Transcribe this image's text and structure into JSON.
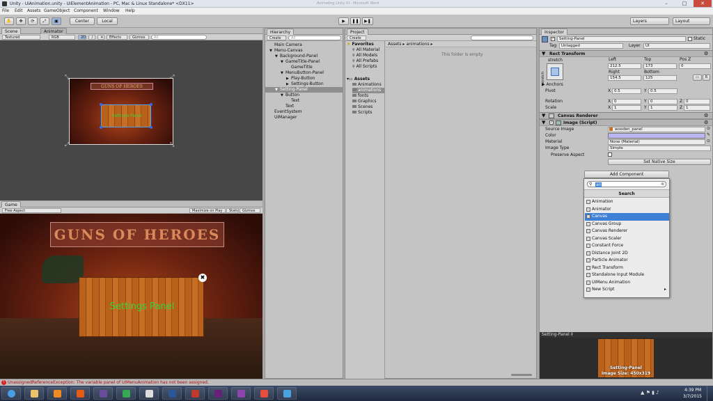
{
  "window": {
    "title": "Unity - UiAnimation.unity - UiElementAnimation - PC, Mac & Linux Standalone* <DX11>",
    "ghost_title": "Animating Unity UI - Microsoft Word",
    "min": "–",
    "max": "□",
    "close": "✕"
  },
  "menu": [
    "File",
    "Edit",
    "Assets",
    "GameObject",
    "Component",
    "Window",
    "Help"
  ],
  "toolbar": {
    "tools": [
      "✋",
      "✥",
      "⟳",
      "⤢",
      "▣"
    ],
    "pivot": "Center",
    "space": "Local",
    "play": "▶",
    "pause": "❚❚",
    "step": "▶❚",
    "layers": "Layers",
    "layout": "Layout"
  },
  "scene": {
    "tabs": [
      "Scene",
      "Animator"
    ],
    "shading": "Textured",
    "rgb": "RGB",
    "mode2d": "2D",
    "effects": "Effects",
    "gizmos": "Gizmos",
    "search_placeholder": "All",
    "panel_text": "Settings Panel",
    "logo_text": "GUNS OF HEROES"
  },
  "game": {
    "tab": "Game",
    "aspect": "Free Aspect",
    "maximize": "Maximize on Play",
    "stats": "Stats",
    "gizmos": "Gizmos",
    "panel_text": "Settings Panel",
    "logo_text": "GUNS OF HEROES",
    "close_glyph": "✖"
  },
  "hierarchy": {
    "tab": "Hierarchy",
    "create": "Create",
    "search_placeholder": "All",
    "items": [
      {
        "label": "Main Camera",
        "indent": 0,
        "arrow": ""
      },
      {
        "label": "Menu-Canvas",
        "indent": 0,
        "arrow": "▼"
      },
      {
        "label": "Background-Panel",
        "indent": 1,
        "arrow": "▼"
      },
      {
        "label": "GameTitle-Panel",
        "indent": 2,
        "arrow": "▼"
      },
      {
        "label": "GameTitle",
        "indent": 3,
        "arrow": ""
      },
      {
        "label": "MenuButton-Panel",
        "indent": 2,
        "arrow": "▼"
      },
      {
        "label": "Play-Button",
        "indent": 3,
        "arrow": "▶"
      },
      {
        "label": "Settings-Button",
        "indent": 3,
        "arrow": "▶"
      },
      {
        "label": "Setting-Panel",
        "indent": 1,
        "arrow": "▼",
        "selected": true
      },
      {
        "label": "Button",
        "indent": 2,
        "arrow": "▼"
      },
      {
        "label": "Text",
        "indent": 3,
        "arrow": ""
      },
      {
        "label": "Text",
        "indent": 2,
        "arrow": ""
      },
      {
        "label": "EventSystem",
        "indent": 0,
        "arrow": ""
      },
      {
        "label": "UIManager",
        "indent": 0,
        "arrow": ""
      }
    ]
  },
  "project": {
    "tab": "Project",
    "create": "Create",
    "breadcrumb": "Assets ▸ animations ▸",
    "empty": "This folder is empty",
    "favorites_label": "Favorites",
    "favorites": [
      "All Material",
      "All Models",
      "All Prefabs",
      "All Scripts"
    ],
    "assets_label": "Assets",
    "folders": [
      "Animations",
      "animations",
      "fonts",
      "Graphics",
      "Scenes",
      "Scripts"
    ]
  },
  "inspector": {
    "tab": "Inspector",
    "name": "Setting-Panel",
    "static": "Static",
    "tag_label": "Tag",
    "tag": "Untagged",
    "layer_label": "Layer",
    "layer": "UI",
    "rect_transform": "Rect Transform",
    "stretch": "stretch",
    "left_label": "Left",
    "top_label": "Top",
    "posz_label": "Pos Z",
    "left": "212.5",
    "top": "173",
    "posz": "0",
    "right_label": "Right",
    "bottom_label": "Bottom",
    "right": "154.5",
    "bottom": "125",
    "raw_btn": "R",
    "anchors": "Anchors",
    "pivot_label": "Pivot",
    "pivot_x": "0.5",
    "pivot_y": "0.5",
    "rotation_label": "Rotation",
    "rot_x": "0",
    "rot_y": "0",
    "rot_z": "0",
    "scale_label": "Scale",
    "scale_x": "1",
    "scale_y": "1",
    "scale_z": "1",
    "x": "X",
    "y": "Y",
    "z": "Z",
    "canvas_renderer": "Canvas Renderer",
    "image_script": "Image (Script)",
    "source_image_label": "Source Image",
    "source_image": "wooden_panel",
    "color_label": "Color",
    "color_value": "#b9b6f0",
    "material_label": "Material",
    "material": "None (Material)",
    "image_type_label": "Image Type",
    "image_type": "Simple",
    "preserve_aspect": "Preserve Aspect",
    "set_native": "Set Native Size",
    "add_component": "Add Component"
  },
  "popup": {
    "search_value": "an",
    "title": "Search",
    "items": [
      {
        "label": "Animation",
        "selected": false
      },
      {
        "label": "Animator",
        "selected": false
      },
      {
        "label": "Canvas",
        "selected": true
      },
      {
        "label": "Canvas Group",
        "selected": false
      },
      {
        "label": "Canvas Renderer",
        "selected": false
      },
      {
        "label": "Canvas Scaler",
        "selected": false
      },
      {
        "label": "Constant Force",
        "selected": false
      },
      {
        "label": "Distance Joint 2D",
        "selected": false
      },
      {
        "label": "Particle Animator",
        "selected": false
      },
      {
        "label": "Rect Transform",
        "selected": false
      },
      {
        "label": "Standalone Input Module",
        "selected": false
      },
      {
        "label": "UIMenu Animation",
        "selected": false
      },
      {
        "label": "New Script",
        "selected": false
      }
    ]
  },
  "preview": {
    "title": "Setting-Panel ‡",
    "name": "Setting-Panel",
    "size": "Image Size: 450x319"
  },
  "status": {
    "message": "UnassignedReferenceException: The variable panel of UIMenuAnimation has not been assigned."
  },
  "taskbar": {
    "time": "4:39 PM",
    "date": "3/7/2015",
    "apps": [
      {
        "name": "start",
        "color": "#4a9de0"
      },
      {
        "name": "explorer",
        "color": "#e9c46a"
      },
      {
        "name": "media",
        "color": "#f08a24"
      },
      {
        "name": "firefox",
        "color": "#e55b13"
      },
      {
        "name": "eclipse",
        "color": "#6a4c9c"
      },
      {
        "name": "chrome",
        "color": "#34a853"
      },
      {
        "name": "unity",
        "color": "#dddddd"
      },
      {
        "name": "word",
        "color": "#2b579a"
      },
      {
        "name": "paint",
        "color": "#c0392b"
      },
      {
        "name": "visualstudio",
        "color": "#68217a"
      },
      {
        "name": "winrar",
        "color": "#8e44ad"
      },
      {
        "name": "snipping",
        "color": "#e74c3c"
      },
      {
        "name": "network",
        "color": "#4aa3df"
      }
    ]
  }
}
